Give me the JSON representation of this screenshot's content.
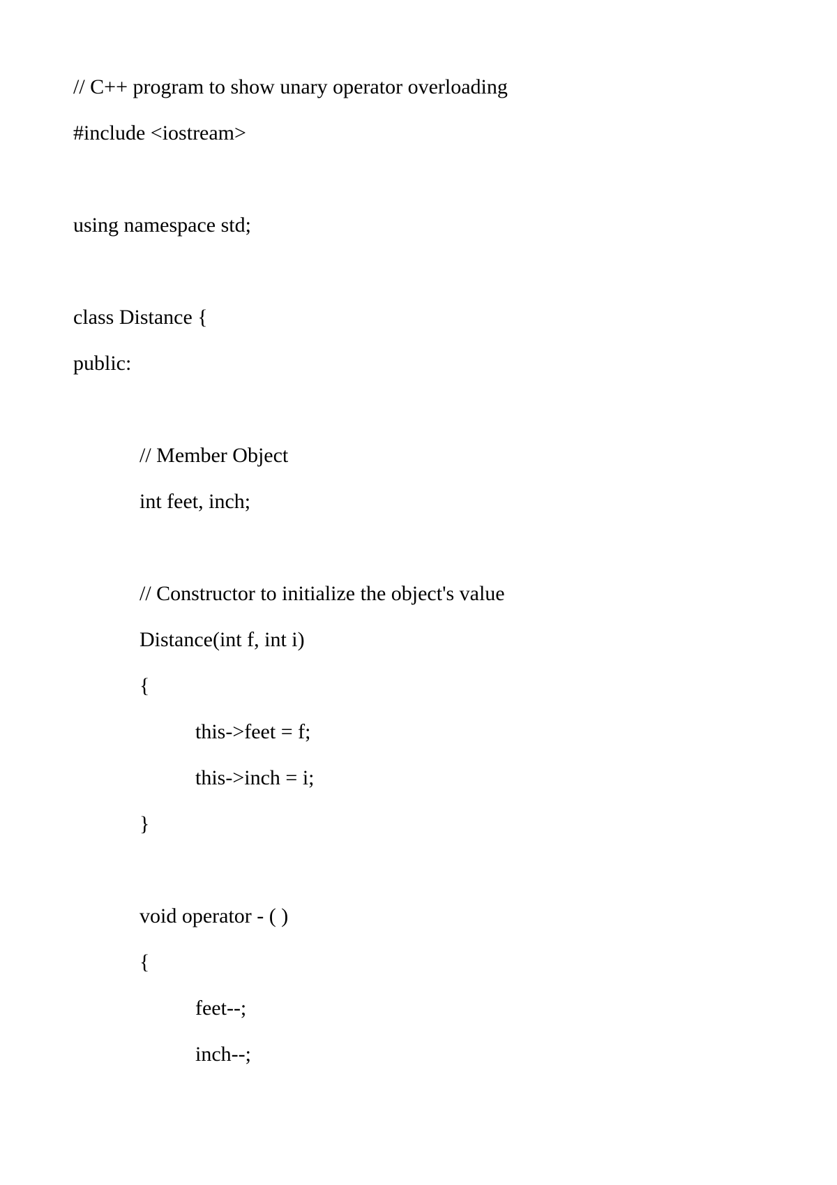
{
  "code": {
    "lines": [
      "// C++ program to show unary operator overloading",
      "#include <iostream>",
      "",
      "using namespace std;",
      "",
      "class Distance {",
      "public:",
      "",
      "// Member Object",
      "int feet, inch;",
      "",
      "// Constructor to initialize the object's value",
      "Distance(int f, int i)",
      "{",
      "this->feet = f;",
      "this->inch = i;",
      "}",
      "",
      "void operator - ( )",
      "{",
      "feet--;",
      "inch--;"
    ]
  }
}
